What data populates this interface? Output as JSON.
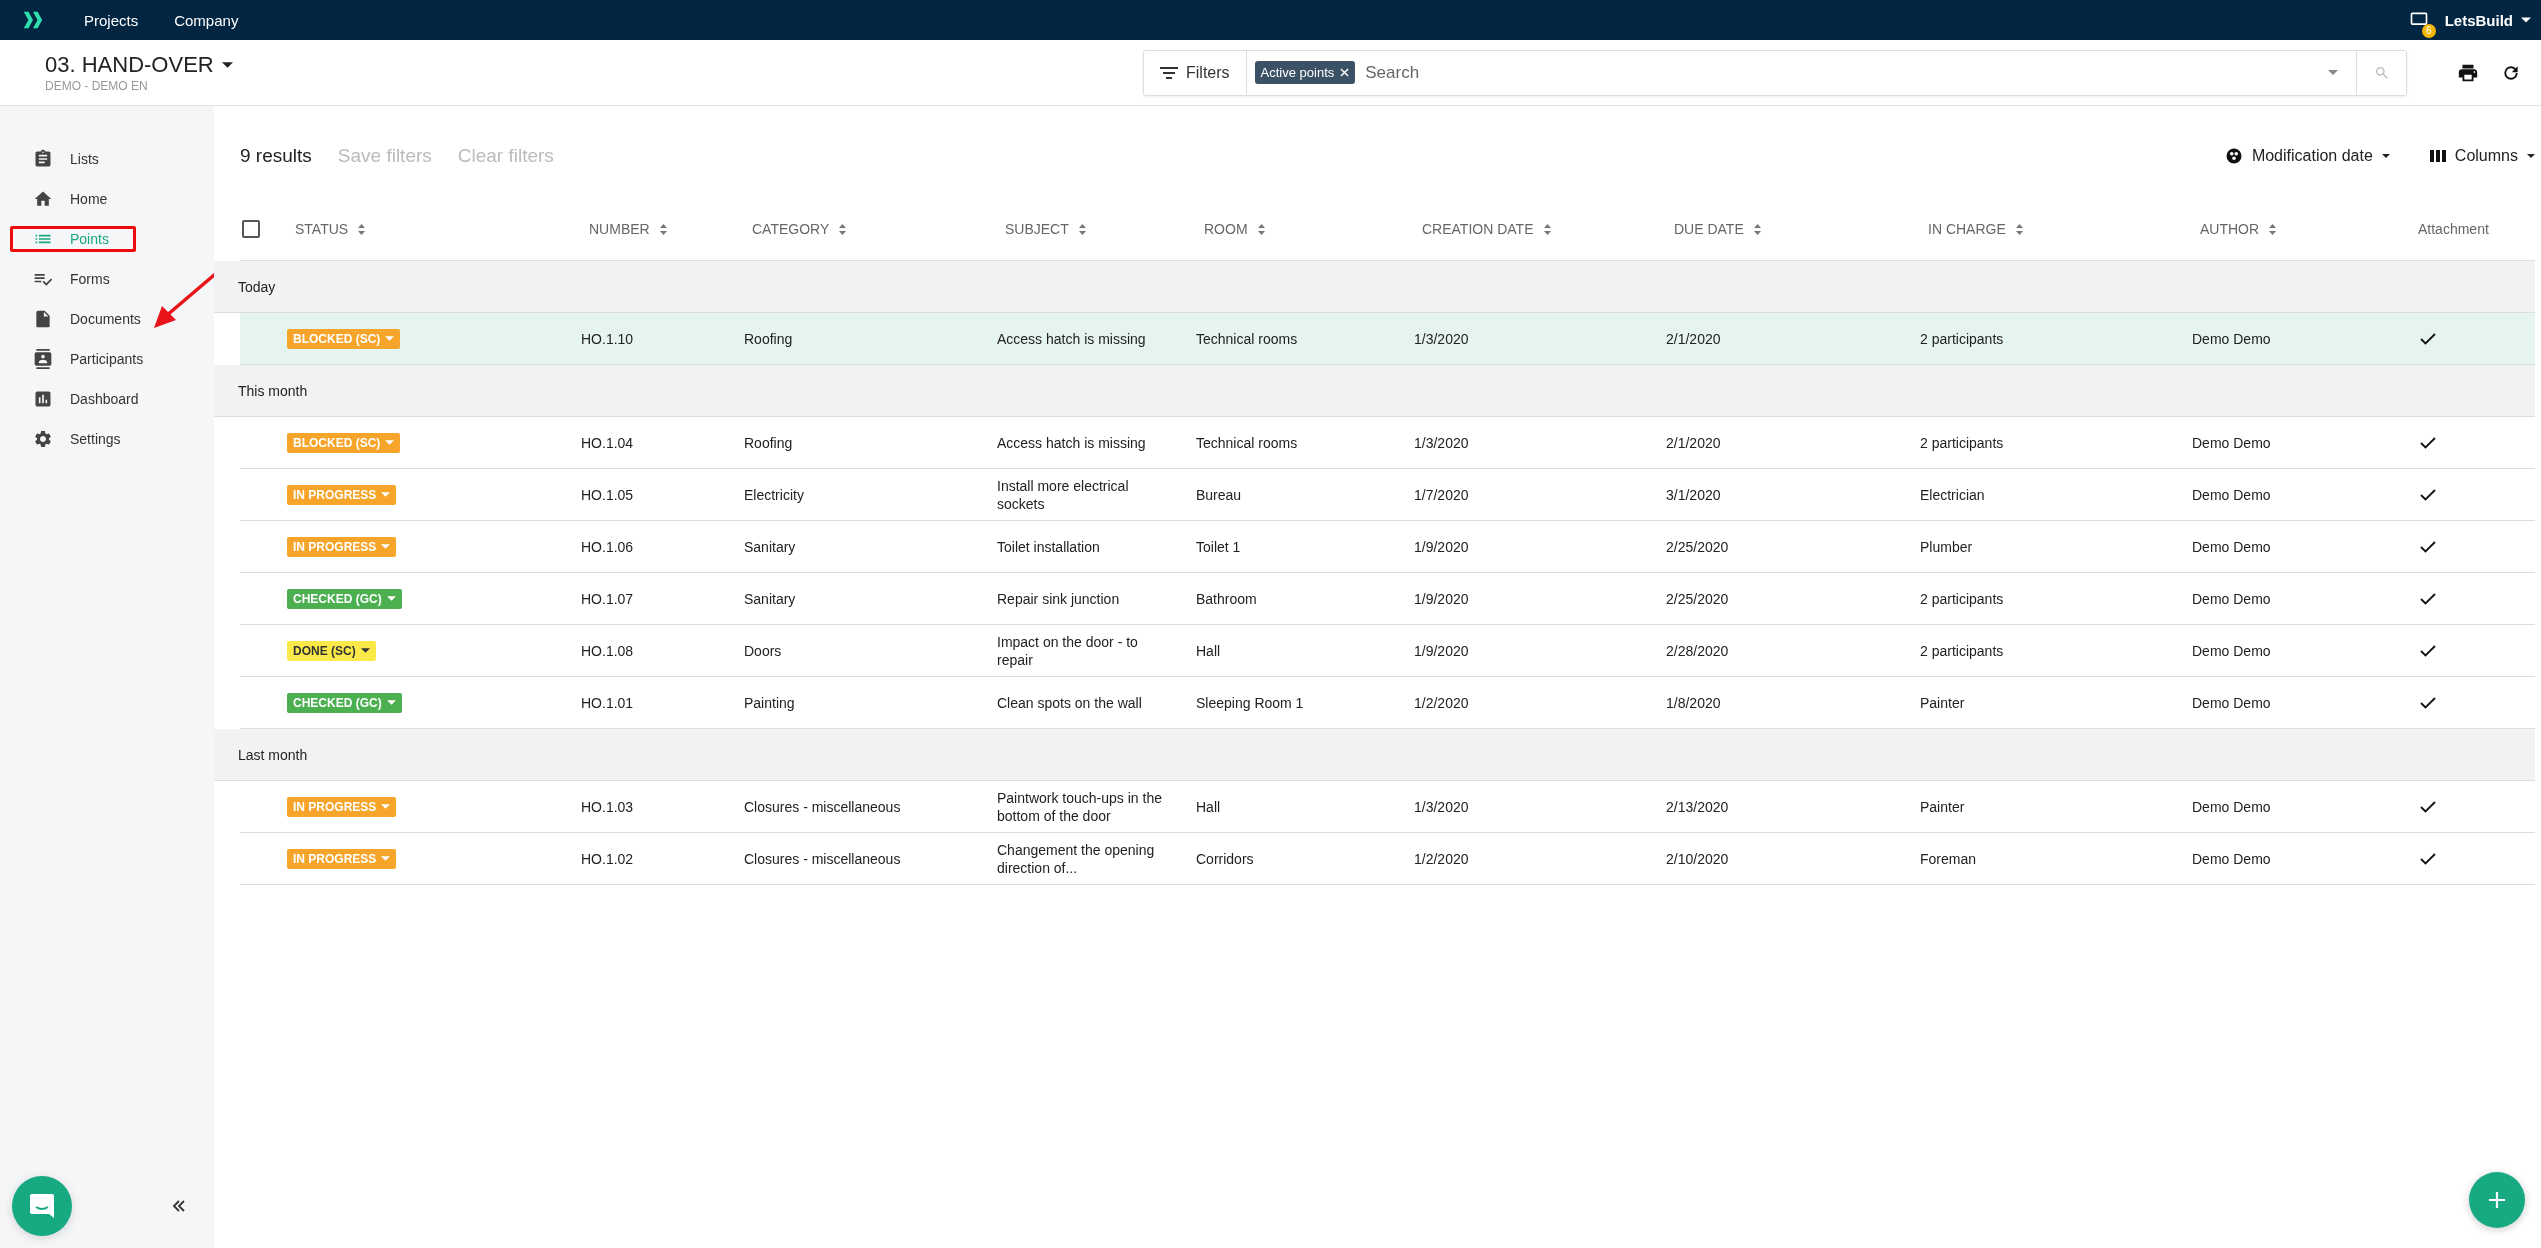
{
  "topbar": {
    "nav": [
      "Projects",
      "Company"
    ],
    "notification_count": "6",
    "account": "LetsBuild"
  },
  "project": {
    "title": "03. HAND-OVER",
    "subtitle": "DEMO - DEMO EN"
  },
  "filter_bar": {
    "filters_label": "Filters",
    "chips": [
      "Active points"
    ],
    "search": {
      "placeholder": "Search"
    }
  },
  "sidebar": {
    "items": [
      {
        "label": "Lists",
        "selected": false,
        "highlighted": false
      },
      {
        "label": "Home",
        "selected": false,
        "highlighted": false
      },
      {
        "label": "Points",
        "selected": true,
        "highlighted": true
      },
      {
        "label": "Forms",
        "selected": false,
        "highlighted": false
      },
      {
        "label": "Documents",
        "selected": false,
        "highlighted": false
      },
      {
        "label": "Participants",
        "selected": false,
        "highlighted": false
      },
      {
        "label": "Dashboard",
        "selected": false,
        "highlighted": false
      },
      {
        "label": "Settings",
        "selected": false,
        "highlighted": false
      }
    ]
  },
  "toolbar": {
    "results": "9 results",
    "save_filters": {
      "label": "Save filters",
      "disabled": true
    },
    "clear_filters": {
      "label": "Clear filters",
      "disabled": true
    },
    "sort": "Modification date",
    "columns": "Columns"
  },
  "table": {
    "select_all": {
      "checked": false
    },
    "columns": [
      {
        "label": "STATUS",
        "sortable": true
      },
      {
        "label": "NUMBER",
        "sortable": true
      },
      {
        "label": "CATEGORY",
        "sortable": true
      },
      {
        "label": "SUBJECT",
        "sortable": true
      },
      {
        "label": "ROOM",
        "sortable": true
      },
      {
        "label": "CREATION DATE",
        "sortable": true
      },
      {
        "label": "DUE DATE",
        "sortable": true
      },
      {
        "label": "IN CHARGE",
        "sortable": true
      },
      {
        "label": "AUTHOR",
        "sortable": true
      },
      {
        "label": "Attachment",
        "sortable": false
      }
    ],
    "groups": [
      {
        "label": "Today",
        "rows": [
          {
            "status": "BLOCKED (SC)",
            "color": "#f7a52a",
            "number": "HO.1.10",
            "category": "Roofing",
            "subject": "Access hatch is missing",
            "room": "Technical rooms",
            "created": "1/3/2020",
            "due": "2/1/2020",
            "in_charge": "2 participants",
            "author": "Demo Demo",
            "attachment": true,
            "selected": true
          }
        ]
      },
      {
        "label": "This month",
        "rows": [
          {
            "status": "BLOCKED (SC)",
            "color": "#f7a52a",
            "number": "HO.1.04",
            "category": "Roofing",
            "subject": "Access hatch is missing",
            "room": "Technical rooms",
            "created": "1/3/2020",
            "due": "2/1/2020",
            "in_charge": "2 participants",
            "author": "Demo Demo",
            "attachment": true,
            "selected": false
          },
          {
            "status": "IN PROGRESS",
            "color": "#f7a52a",
            "number": "HO.1.05",
            "category": "Electricity",
            "subject": "Install more electrical sockets",
            "room": "Bureau",
            "created": "1/7/2020",
            "due": "3/1/2020",
            "in_charge": "Electrician",
            "author": "Demo Demo",
            "attachment": true,
            "selected": false
          },
          {
            "status": "IN PROGRESS",
            "color": "#f7a52a",
            "number": "HO.1.06",
            "category": "Sanitary",
            "subject": "Toilet installation",
            "room": "Toilet 1",
            "created": "1/9/2020",
            "due": "2/25/2020",
            "in_charge": "Plumber",
            "author": "Demo Demo",
            "attachment": true,
            "selected": false
          },
          {
            "status": "CHECKED (GC)",
            "color": "#4caf50",
            "number": "HO.1.07",
            "category": "Sanitary",
            "subject": "Repair sink junction",
            "room": "Bathroom",
            "created": "1/9/2020",
            "due": "2/25/2020",
            "in_charge": "2 participants",
            "author": "Demo Demo",
            "attachment": true,
            "selected": false
          },
          {
            "status": "DONE (SC)",
            "color": "#fbe94a",
            "number": "HO.1.08",
            "category": "Doors",
            "subject": "Impact on the door - to repair",
            "room": "Hall",
            "created": "1/9/2020",
            "due": "2/28/2020",
            "in_charge": "2 participants",
            "author": "Demo Demo",
            "attachment": true,
            "selected": false
          },
          {
            "status": "CHECKED (GC)",
            "color": "#4caf50",
            "number": "HO.1.01",
            "category": "Painting",
            "subject": "Clean spots on the wall",
            "room": "Sleeping Room 1",
            "created": "1/2/2020",
            "due": "1/8/2020",
            "in_charge": "Painter",
            "author": "Demo Demo",
            "attachment": true,
            "selected": false
          }
        ]
      },
      {
        "label": "Last month",
        "rows": [
          {
            "status": "IN PROGRESS",
            "color": "#f7a52a",
            "number": "HO.1.03",
            "category": "Closures - miscellaneous",
            "subject": "Paintwork touch-ups in the bottom of the door",
            "room": "Hall",
            "created": "1/3/2020",
            "due": "2/13/2020",
            "in_charge": "Painter",
            "author": "Demo Demo",
            "attachment": true,
            "selected": false
          },
          {
            "status": "IN PROGRESS",
            "color": "#f7a52a",
            "number": "HO.1.02",
            "category": "Closures - miscellaneous",
            "subject": "Changement the opening direction of...",
            "room": "Corridors",
            "created": "1/2/2020",
            "due": "2/10/2020",
            "in_charge": "Foreman",
            "author": "Demo Demo",
            "attachment": true,
            "selected": false
          }
        ]
      }
    ]
  }
}
